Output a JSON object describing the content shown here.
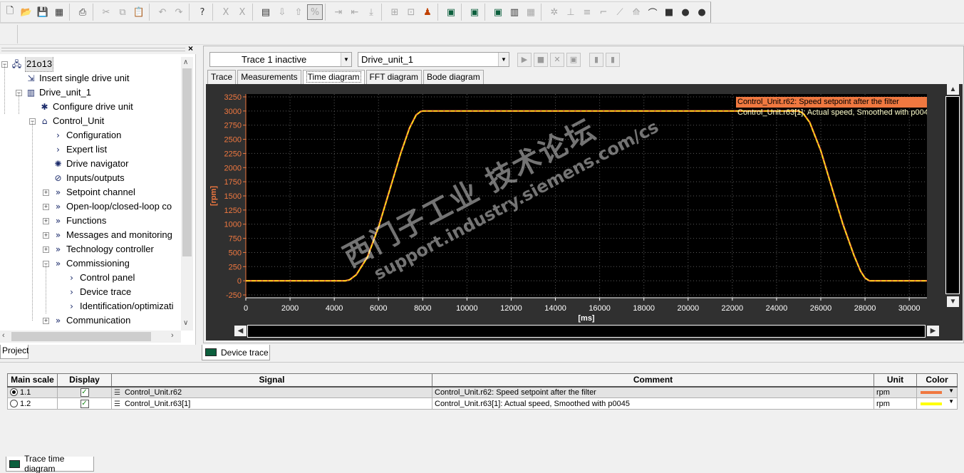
{
  "toolbar": {
    "icons": [
      "new-icon",
      "open-icon",
      "save-icon",
      "save-compile-icon",
      "print-icon",
      "cut-icon",
      "copy-icon",
      "paste-icon",
      "undo-icon",
      "redo-icon",
      "help-icon",
      "font-icon",
      "font-style-icon",
      "highlight-icon",
      "download-icon",
      "upload-icon",
      "accessible-icon",
      "connect-icon",
      "disconnect-icon",
      "load-to-pg-icon",
      "copy-ram-rom-icon",
      "diagnostics-icon",
      "device-icon",
      "trace-icon",
      "signal-icon",
      "oscilloscope-icon",
      "measure-icon",
      "table-icon",
      "config-icon",
      "profile-icon",
      "ramp-icon",
      "step-icon",
      "ramp2-icon",
      "filter-icon",
      "curve-icon",
      "record-icon",
      "circle1-icon",
      "circle2-icon"
    ]
  },
  "project": {
    "tab_label": "Project",
    "tree": [
      {
        "label": "21o13",
        "icon": "project-icon",
        "level": 0,
        "exp": "−"
      },
      {
        "label": "Insert single drive unit",
        "icon": "insert-icon",
        "level": 1
      },
      {
        "label": "Drive_unit_1",
        "icon": "drive-icon",
        "level": 1,
        "exp": "−"
      },
      {
        "label": "Configure drive unit",
        "icon": "wizard-icon",
        "level": 2
      },
      {
        "label": "Control_Unit",
        "icon": "control-unit-icon",
        "level": 2,
        "exp": "−"
      },
      {
        "label": "Configuration",
        "icon": "chevron-icon",
        "level": 3
      },
      {
        "label": "Expert list",
        "icon": "chevron-icon",
        "level": 3
      },
      {
        "label": "Drive navigator",
        "icon": "navigator-icon",
        "level": 3
      },
      {
        "label": "Inputs/outputs",
        "icon": "io-icon",
        "level": 3
      },
      {
        "label": "Setpoint channel",
        "icon": "double-chevron-icon",
        "level": 3,
        "exp": "+"
      },
      {
        "label": "Open-loop/closed-loop co",
        "icon": "double-chevron-icon",
        "level": 3,
        "exp": "+"
      },
      {
        "label": "Functions",
        "icon": "double-chevron-icon",
        "level": 3,
        "exp": "+"
      },
      {
        "label": "Messages and monitoring",
        "icon": "double-chevron-icon",
        "level": 3,
        "exp": "+"
      },
      {
        "label": "Technology controller",
        "icon": "double-chevron-icon",
        "level": 3,
        "exp": "+"
      },
      {
        "label": "Commissioning",
        "icon": "double-chevron-icon",
        "level": 3,
        "exp": "−"
      },
      {
        "label": "Control panel",
        "icon": "chevron-icon",
        "level": 4
      },
      {
        "label": "Device trace",
        "icon": "chevron-icon",
        "level": 4
      },
      {
        "label": "Identification/optimizati",
        "icon": "chevron-icon",
        "level": 4
      },
      {
        "label": "Communication",
        "icon": "double-chevron-icon",
        "level": 3,
        "exp": "+"
      }
    ]
  },
  "trace": {
    "trace_select": "Trace 1 inactive",
    "device_select": "Drive_unit_1",
    "tabs": [
      "Trace",
      "Measurements",
      "Time diagram",
      "FFT diagram",
      "Bode diagram"
    ],
    "active_tab": "Time diagram",
    "panel_tab": "Device trace"
  },
  "chart_data": {
    "type": "line",
    "xlabel": "[ms]",
    "ylabel": "[rpm]",
    "xlim": [
      0,
      30800
    ],
    "ylim": [
      -300,
      3300
    ],
    "x_ticks": [
      0,
      2000,
      4000,
      6000,
      8000,
      10000,
      12000,
      14000,
      16000,
      18000,
      20000,
      22000,
      24000,
      26000,
      28000,
      30000
    ],
    "y_ticks": [
      -250,
      0,
      250,
      500,
      750,
      1000,
      1250,
      1500,
      1750,
      2000,
      2250,
      2500,
      2750,
      3000,
      3250
    ],
    "grid": true,
    "legend_position": "top-right",
    "series": [
      {
        "name": "Control_Unit.r62: Speed setpoint after the filter",
        "color": "#f07840",
        "x": [
          0,
          4500,
          4700,
          5000,
          5500,
          6000,
          6500,
          7000,
          7400,
          7700,
          7900,
          8000,
          25000,
          25200,
          25500,
          26000,
          26500,
          27000,
          27500,
          27800,
          28000,
          28200,
          30800
        ],
        "y": [
          0,
          0,
          20,
          110,
          420,
          950,
          1600,
          2250,
          2700,
          2930,
          2990,
          3000,
          3000,
          2960,
          2800,
          2300,
          1650,
          1000,
          450,
          170,
          50,
          0,
          0
        ]
      },
      {
        "name": "Control_Unit.r63[1]: Actual speed, Smoothed with p0045",
        "color": "#ffff00",
        "x": [
          0,
          4500,
          4700,
          5000,
          5500,
          6000,
          6500,
          7000,
          7400,
          7700,
          7900,
          8000,
          25000,
          25200,
          25500,
          26000,
          26500,
          27000,
          27500,
          27800,
          28000,
          28200,
          30800
        ],
        "y": [
          0,
          0,
          18,
          105,
          410,
          940,
          1590,
          2240,
          2690,
          2925,
          2988,
          3000,
          3000,
          2955,
          2790,
          2290,
          1640,
          990,
          440,
          165,
          48,
          0,
          0
        ]
      }
    ]
  },
  "watermark": {
    "line1": "西门子工业  技术论坛",
    "line2": "support.industry.siemens.com/cs"
  },
  "signals": {
    "headers": [
      "Main scale",
      "Display",
      "Signal",
      "Comment",
      "Unit",
      "Color"
    ],
    "rows": [
      {
        "scale": "1.1",
        "display": "✓",
        "signal": "Control_Unit.r62",
        "comment": "Control_Unit.r62: Speed setpoint after the filter",
        "unit": "rpm",
        "color": "#f07840",
        "selected": true
      },
      {
        "scale": "1.2",
        "display": "✓",
        "signal": "Control_Unit.r63[1]",
        "comment": "Control_Unit.r63[1]: Actual speed, Smoothed with p0045",
        "unit": "rpm",
        "color": "#ffff00",
        "selected": false
      }
    ],
    "bottom_tab": "Trace time diagram"
  }
}
